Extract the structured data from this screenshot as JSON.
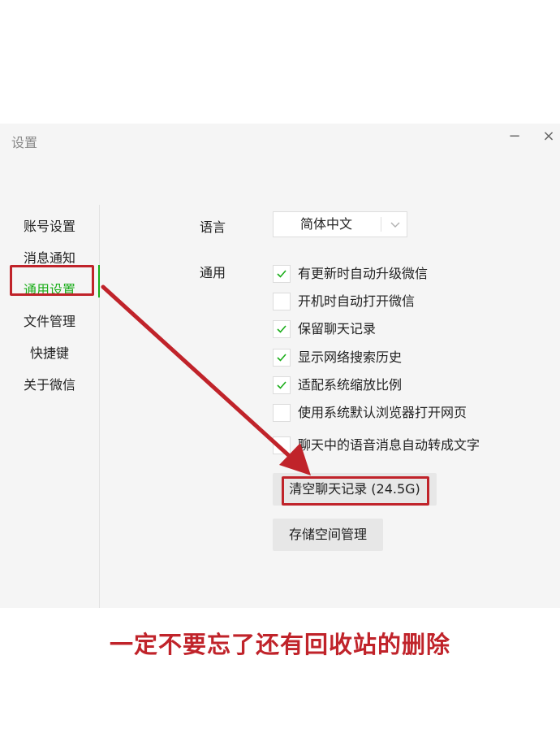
{
  "window": {
    "title": "设置",
    "minimize_label": "−",
    "close_label": "×"
  },
  "sidebar": {
    "items": [
      {
        "label": "账号设置",
        "active": false
      },
      {
        "label": "消息通知",
        "active": false
      },
      {
        "label": "通用设置",
        "active": true
      },
      {
        "label": "文件管理",
        "active": false
      },
      {
        "label": "快捷键",
        "active": false
      },
      {
        "label": "关于微信",
        "active": false
      }
    ]
  },
  "main": {
    "language_label": "语言",
    "language_value": "简体中文",
    "general_label": "通用",
    "options": [
      {
        "label": "有更新时自动升级微信",
        "checked": true
      },
      {
        "label": "开机时自动打开微信",
        "checked": false
      },
      {
        "label": "保留聊天记录",
        "checked": true
      },
      {
        "label": "显示网络搜索历史",
        "checked": true
      },
      {
        "label": "适配系统缩放比例",
        "checked": true
      },
      {
        "label": "使用系统默认浏览器打开网页",
        "checked": false
      },
      {
        "label": "聊天中的语音消息自动转成文字",
        "checked": false
      }
    ],
    "clear_history_button": "清空聊天记录 (24.5G)",
    "storage_button": "存储空间管理"
  },
  "annotation": {
    "caption": "一定不要忘了还有回收站的删除",
    "highlight_color": "#c0232a"
  },
  "colors": {
    "accent": "#1aad19",
    "window_bg": "#f5f5f5",
    "button_bg": "#e7e7e7"
  }
}
